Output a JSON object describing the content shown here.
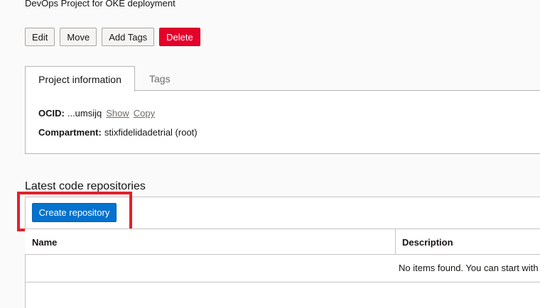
{
  "project": {
    "description": "DevOps Project for OKE deployment"
  },
  "actions": {
    "edit": "Edit",
    "move": "Move",
    "add_tags": "Add Tags",
    "delete": "Delete"
  },
  "tabs": [
    {
      "label": "Project information",
      "active": true
    },
    {
      "label": "Tags",
      "active": false
    }
  ],
  "info": {
    "ocid_label": "OCID:",
    "ocid_value": "...umsijq",
    "show_link": "Show",
    "copy_link": "Copy",
    "compartment_label": "Compartment:",
    "compartment_value": "stixfidelidadetrial (root)"
  },
  "repositories": {
    "title": "Latest code repositories",
    "create_button": "Create repository",
    "columns": [
      "Name",
      "Description"
    ],
    "empty_message": "No items found. You can start with"
  },
  "colors": {
    "primary": "#0572ce",
    "danger": "#e4002b",
    "highlight": "#e3202a"
  }
}
